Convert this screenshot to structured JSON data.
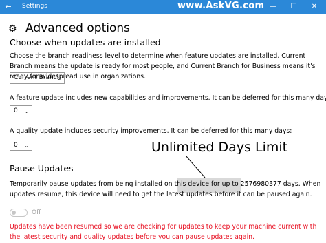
{
  "window": {
    "title": "Settings",
    "watermark": "www.AskVG.com",
    "controls": {
      "minimize": "—",
      "maximize": "☐",
      "close": "✕"
    },
    "back_icon": "←"
  },
  "page": {
    "title": "Advanced options",
    "icon": "gear-icon",
    "icon_glyph": "⚙"
  },
  "choose_section": {
    "heading": "Choose when updates are installed",
    "description": "Choose the branch readiness level to determine when feature updates are installed. Current Branch means the update is ready for most people, and Current Branch for Business means it's ready for widespread use in organizations.",
    "branch_dropdown": {
      "selected": "Current Branch",
      "chevron": "⌄"
    }
  },
  "feature_update": {
    "label": "A feature update includes new capabilities and improvements. It can be deferred for this many days:",
    "days_selected": "0"
  },
  "quality_update": {
    "label": "A quality update includes security improvements. It can be deferred for this many days:",
    "days_selected": "0"
  },
  "annotation": {
    "callout": "Unlimited Days Limit"
  },
  "pause_section": {
    "heading": "Pause Updates",
    "description_pre": "Temporarily pause updates from being installed on this device for ",
    "description_highlight": "up to 2576980377 days.",
    "description_post": " When updates resume, this device will need to get the latest updates before it can be paused again.",
    "toggle_label": "Off",
    "toggle_on": false
  },
  "error": {
    "message": "Updates have been resumed so we are checking for updates to keep your machine current with the latest security and quality updates before you can pause updates again.",
    "color": "#e81123"
  },
  "colors": {
    "titlebar": "#2b88d8",
    "highlight": "#d9d9d9",
    "disabled": "#a0a0a0"
  }
}
